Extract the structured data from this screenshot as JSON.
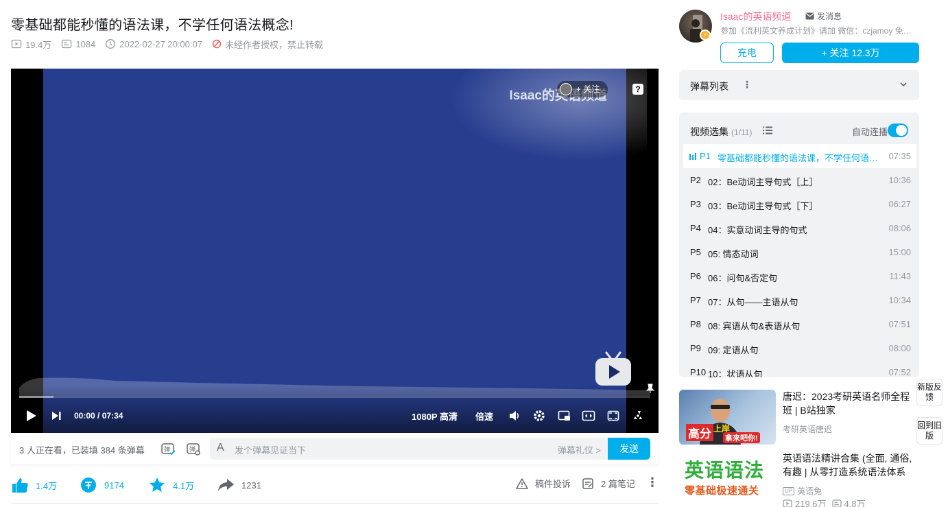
{
  "video": {
    "title": "零基础都能秒懂的语法课，不学任何语法概念!",
    "views": "19.4万",
    "danmaku_count": "1084",
    "pubdate": "2022-02-27 20:00:07",
    "copyright_note": "未经作者授权，禁止转载"
  },
  "player": {
    "watermark": "Isaac的英语频道",
    "follow_chip": "+ 关注",
    "help_label": "?",
    "current_time": "00:00",
    "time_sep": "/",
    "duration": "07:34",
    "quality": "1080P 高清",
    "speed": "倍速",
    "progress_fraction": 0
  },
  "danmaku_bar": {
    "info": "3 人正在看，已装填 384 条弹幕",
    "input_icon": "A",
    "placeholder": "发个弹幕见证当下",
    "etiquette": "弹幕礼仪 >",
    "send": "发送"
  },
  "toolbar": {
    "like": "1.4万",
    "coin": "9174",
    "favorite": "4.1万",
    "share": "1231",
    "report": "稿件投诉",
    "notes": "2 篇笔记",
    "more": "⋮"
  },
  "uploader": {
    "name": "Isaac的英语频道",
    "message": "发消息",
    "description": "参加《流利英文养成计划》请加 微信：czjamoy 免费领取...",
    "charge": "充电",
    "follow": "+ 关注 12.3万"
  },
  "danmaku_list": {
    "label": "弹幕列表",
    "dots": "⋮"
  },
  "episodes": {
    "header": "视频选集",
    "count": "(1/11)",
    "autoplay": "自动连播",
    "autoplay_on": true,
    "items": [
      {
        "p": "P1",
        "title": "零基础都能秒懂的语法课，不学任何语法概念!",
        "duration": "07:35",
        "active": true
      },
      {
        "p": "P2",
        "title": "02：Be动词主导句式［上］",
        "duration": "10:36"
      },
      {
        "p": "P3",
        "title": "03：Be动词主导句式［下］",
        "duration": "06:27"
      },
      {
        "p": "P4",
        "title": "04：实意动词主导的句式",
        "duration": "08:06"
      },
      {
        "p": "P5",
        "title": "05: 情态动词",
        "duration": "15:00"
      },
      {
        "p": "P6",
        "title": "06：问句&否定句",
        "duration": "11:43"
      },
      {
        "p": "P7",
        "title": "07：从句——主语从句",
        "duration": "10:34"
      },
      {
        "p": "P8",
        "title": "08: 宾语从句&表语从句",
        "duration": "07:51"
      },
      {
        "p": "P9",
        "title": "09: 定语从句",
        "duration": "08:00"
      },
      {
        "p": "P10",
        "title": "10：状语从句",
        "duration": "07:52"
      }
    ]
  },
  "side_buttons": {
    "feedback": "新版反馈",
    "old": "回到旧版"
  },
  "recommendations": [
    {
      "title": "唐迟：2023考研英语名师全程班 | B站独家",
      "author": "考研英语唐迟",
      "thumb_text_1": "高分",
      "thumb_text_2": "上岸",
      "thumb_text_3": "拿来吧你!"
    },
    {
      "title": "英语语法精讲合集 (全面, 通俗, 有趣 | 从零打造系统语法体系",
      "author": "英语兔",
      "up_tag": "UP",
      "plays": "219.6万",
      "danmakus": "4.8万",
      "thumb_text_1": "英语语法",
      "thumb_text_2": "零基础极速通关"
    }
  ],
  "colors": {
    "accent": "#00aeec",
    "pink": "#fb7299",
    "video_bg": "#273e8f"
  }
}
